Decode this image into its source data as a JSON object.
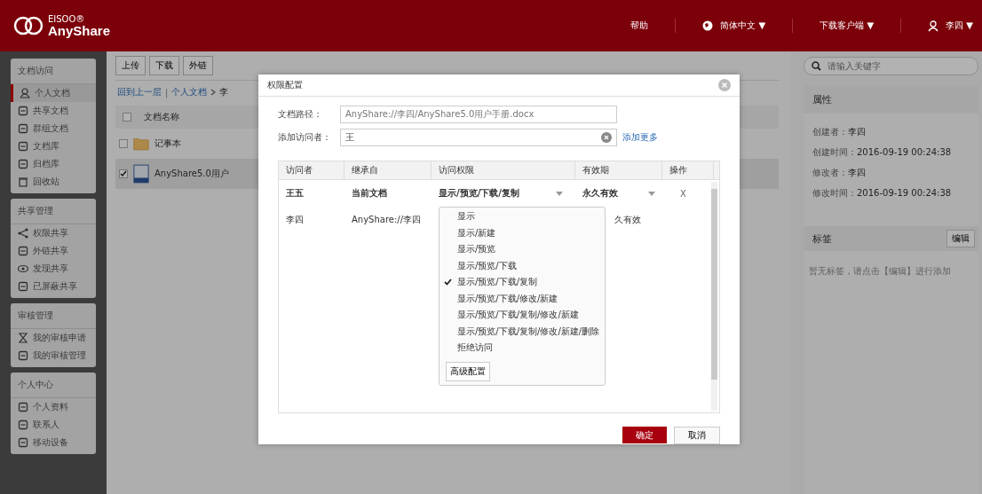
{
  "header": {
    "logo_top": "EISOO®",
    "logo_name": "AnyShare",
    "links": [
      "帮助"
    ],
    "language": "简体中文 ▼",
    "download": "下载客户端 ▼",
    "user": "李四 ▼"
  },
  "sidebar": [
    {
      "title": "文档访问",
      "items": [
        {
          "label": "个人文档",
          "selected": true
        },
        {
          "label": "共享文档",
          "selected": false
        },
        {
          "label": "群组文档",
          "selected": false
        },
        {
          "label": "文档库",
          "selected": false
        },
        {
          "label": "归档库",
          "selected": false
        },
        {
          "label": "回收站",
          "selected": false
        }
      ]
    },
    {
      "title": "共享管理",
      "items": [
        {
          "label": "权限共享",
          "selected": false
        },
        {
          "label": "外链共享",
          "selected": false
        },
        {
          "label": "发现共享",
          "selected": false
        },
        {
          "label": "已屏蔽共享",
          "selected": false
        }
      ]
    },
    {
      "title": "审核管理",
      "items": [
        {
          "label": "我的审核申请",
          "selected": false
        },
        {
          "label": "我的审核管理",
          "selected": false
        }
      ]
    },
    {
      "title": "个人中心",
      "items": [
        {
          "label": "个人资料",
          "selected": false
        },
        {
          "label": "联系人",
          "selected": false
        },
        {
          "label": "移动设备",
          "selected": false
        }
      ]
    }
  ],
  "toolbar": [
    "上传",
    "下载",
    "外链"
  ],
  "breadcrumb": {
    "back": "回到上一层",
    "separator": "|",
    "path": [
      "个人文档",
      "李"
    ]
  },
  "file_list": {
    "column": "文档名称",
    "checked": false,
    "rows": [
      {
        "kind": "folder",
        "name": "记事本",
        "checked": false
      },
      {
        "kind": "doc",
        "name": "AnyShare5.0用户",
        "checked": true
      }
    ]
  },
  "search": {
    "placeholder": "请输入关键字"
  },
  "properties": {
    "title": "属性",
    "fields": [
      {
        "label": "创建者：",
        "value": "李四"
      },
      {
        "label": "创建时间：",
        "value": "2016-09-19 00:24:38"
      },
      {
        "label": "修改者：",
        "value": "李四"
      },
      {
        "label": "修改时间：",
        "value": "2016-09-19 00:24:38"
      }
    ]
  },
  "tags": {
    "title": "标签",
    "edit": "编辑",
    "empty": "暂无标签，请点击【编辑】进行添加"
  },
  "dialog": {
    "title": "权限配置",
    "path_label": "文档路径：",
    "path_value": "AnyShare://李四/AnyShare5.0用户手册.docx",
    "visitor_label": "添加访问者：",
    "visitor_value": "王",
    "add_more": "添加更多",
    "columns": [
      "访问者",
      "继承自",
      "访问权限",
      "有效期",
      "操作"
    ],
    "rows": [
      {
        "kind": "editable",
        "visitor": "王五",
        "source": "当前文档",
        "permission": "显示/预览/下载/复制",
        "expiry": "永久有效",
        "action": "X"
      },
      {
        "kind": "inherited",
        "visitor": "李四",
        "source": "AnyShare://李四",
        "expiry": "久有效"
      }
    ],
    "options": [
      {
        "label": "显示",
        "selected": false
      },
      {
        "label": "显示/新建",
        "selected": false
      },
      {
        "label": "显示/预览",
        "selected": false
      },
      {
        "label": "显示/预览/下载",
        "selected": false
      },
      {
        "label": "显示/预览/下载/复制",
        "selected": true
      },
      {
        "label": "显示/预览/下载/修改/新建",
        "selected": false
      },
      {
        "label": "显示/预览/下载/复制/修改/新建",
        "selected": false
      },
      {
        "label": "显示/预览/下载/复制/修改/新建/删除",
        "selected": false
      },
      {
        "label": "拒绝访问",
        "selected": false
      }
    ],
    "advanced": "高级配置",
    "ok": "确定",
    "cancel": "取消"
  }
}
